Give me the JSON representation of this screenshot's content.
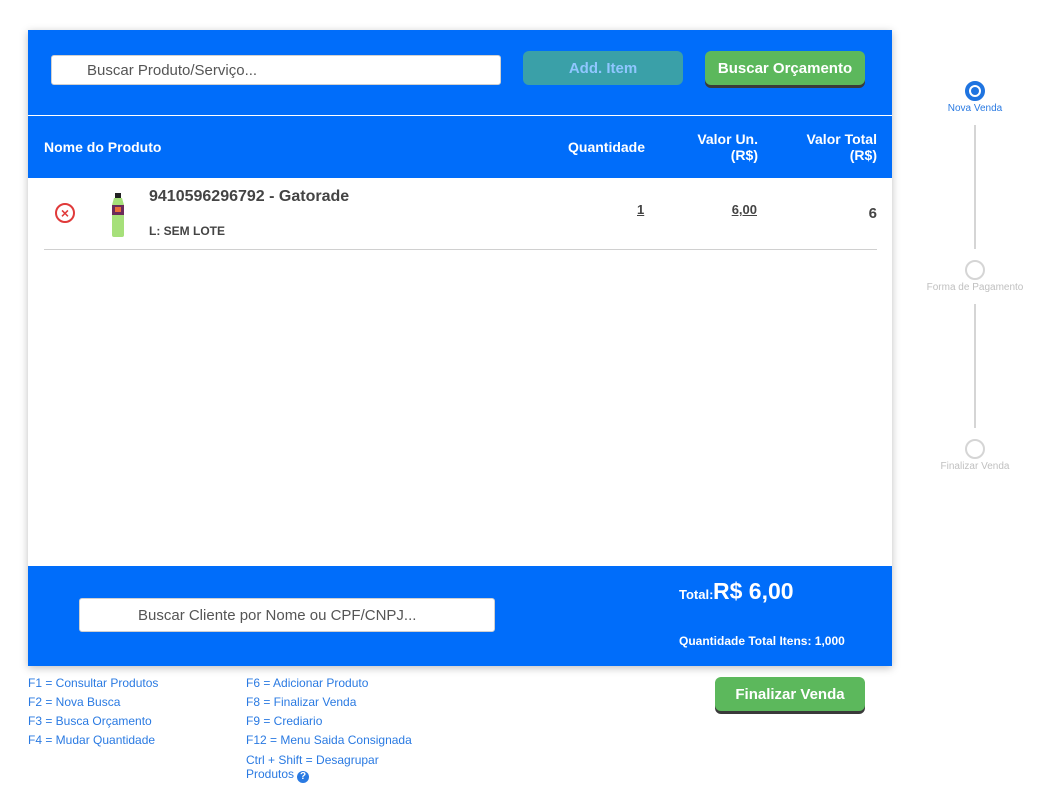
{
  "search": {
    "product_placeholder": "Buscar Produto/Serviço...",
    "client_placeholder": "Buscar Cliente por Nome ou CPF/CNPJ..."
  },
  "toolbar": {
    "add_item": "Add. Item",
    "buscar_orcamento": "Buscar Orçamento"
  },
  "table": {
    "headers": {
      "name": "Nome do Produto",
      "quantity": "Quantidade",
      "unit_line1": "Valor Un.",
      "unit_line2": "(R$)",
      "total_line1": "Valor Total",
      "total_line2": "(R$)"
    },
    "rows": [
      {
        "name": "9410596296792 - Gatorade",
        "lote": "L: SEM LOTE",
        "quantity": "1",
        "unit_value": "6,00",
        "total_value": "6"
      }
    ]
  },
  "footer": {
    "total_label": "Total:",
    "total_value": "R$ 6,00",
    "qty_label": "Quantidade Total Itens:",
    "qty_value": "1,000"
  },
  "finalize": "Finalizar Venda",
  "shortcuts": {
    "col1": [
      "F1 = Consultar Produtos",
      "F2 = Nova Busca",
      "F3 = Busca Orçamento",
      "F4 = Mudar Quantidade"
    ],
    "col2": [
      "F6 = Adicionar Produto",
      "F8 = Finalizar Venda",
      "F9 = Crediario",
      "F12 = Menu Saida Consignada"
    ],
    "col2_last_line1": "Ctrl + Shift = Desagrupar",
    "col2_last_line2": "Produtos",
    "help_icon": "?"
  },
  "steps": [
    {
      "label": "Nova Venda",
      "active": true
    },
    {
      "label": "Forma de Pagamento",
      "active": false
    },
    {
      "label": "Finalizar Venda",
      "active": false
    }
  ],
  "colors": {
    "primary": "#006dfa",
    "success": "#5cb85c",
    "danger": "#e03a3a",
    "link": "#2a7ae2"
  }
}
